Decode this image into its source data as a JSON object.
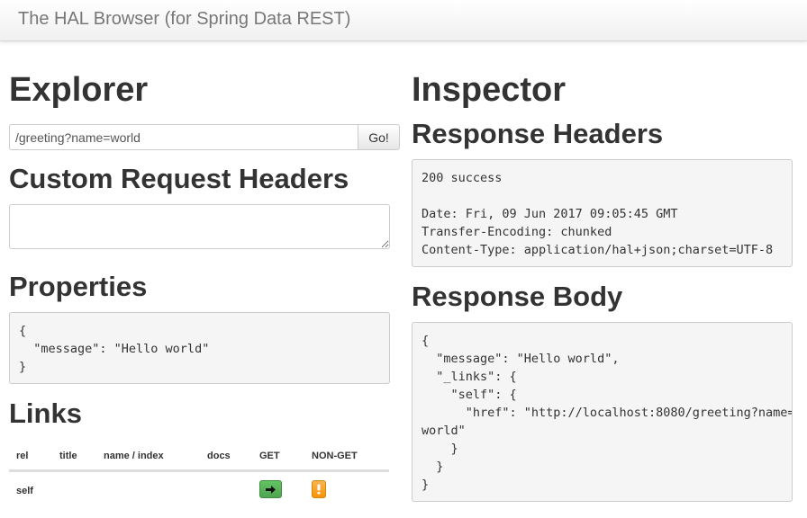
{
  "app": {
    "title": "The HAL Browser (for Spring Data REST)"
  },
  "explorer": {
    "title": "Explorer",
    "url_value": "/greeting?name=world",
    "go_label": "Go!",
    "custom_headers_title": "Custom Request Headers",
    "custom_headers_value": "",
    "properties_title": "Properties",
    "properties_body": "{\n  \"message\": \"Hello world\"\n}",
    "links_title": "Links",
    "links_columns": [
      "rel",
      "title",
      "name / index",
      "docs",
      "GET",
      "NON-GET"
    ],
    "links_rows": [
      {
        "rel": "self",
        "title": "",
        "name_index": "",
        "docs": "",
        "get_icon": "arrow-right-icon",
        "nonget_icon": "exclamation-icon"
      }
    ]
  },
  "inspector": {
    "title": "Inspector",
    "response_headers_title": "Response Headers",
    "response_headers_body": "200 success\n\nDate: Fri, 09 Jun 2017 09:05:45 GMT\nTransfer-Encoding: chunked\nContent-Type: application/hal+json;charset=UTF-8",
    "response_body_title": "Response Body",
    "response_body": "{\n  \"message\": \"Hello world\",\n  \"_links\": {\n    \"self\": {\n      \"href\": \"http://localhost:8080/greeting?name=\nworld\"\n    }\n  }\n}"
  },
  "colors": {
    "get_button": "#51a351",
    "nonget_button": "#f89406",
    "pre_background": "#f5f5f5"
  }
}
